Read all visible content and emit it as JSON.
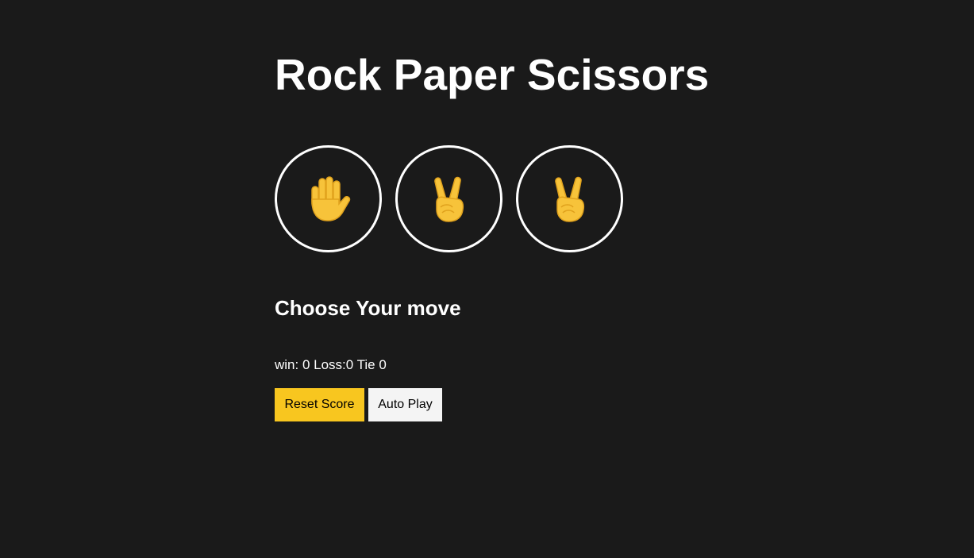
{
  "page": {
    "title": "Rock Paper Scissors",
    "prompt": "Choose Your move",
    "score_text": "win: 0 Loss:0 Tie 0"
  },
  "moves": [
    {
      "icon": "raised-hand-icon",
      "emoji": "🖐"
    },
    {
      "icon": "victory-hand-icon",
      "emoji": "✌"
    },
    {
      "icon": "victory-hand-icon",
      "emoji": "✌"
    }
  ],
  "actions": {
    "reset_label": "Reset Score",
    "autoplay_label": "Auto Play"
  },
  "colors": {
    "background": "#1a1a1a",
    "text": "#ffffff",
    "accent": "#f8c61f",
    "secondary_button": "#f4f4f4",
    "hand_fill": "#f7c33a",
    "hand_outline": "#e0a21d"
  }
}
